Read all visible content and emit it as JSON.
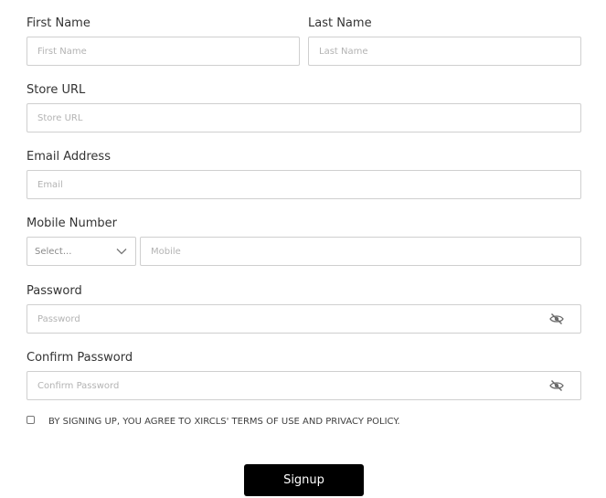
{
  "form": {
    "first_name": {
      "label": "First Name",
      "placeholder": "First Name",
      "value": ""
    },
    "last_name": {
      "label": "Last Name",
      "placeholder": "Last Name",
      "value": ""
    },
    "store_url": {
      "label": "Store URL",
      "placeholder": "Store URL",
      "value": ""
    },
    "email": {
      "label": "Email Address",
      "placeholder": "Email",
      "value": ""
    },
    "mobile": {
      "label": "Mobile Number",
      "country_code_selected": "Select...",
      "placeholder": "Mobile",
      "value": ""
    },
    "password": {
      "label": "Password",
      "placeholder": "Password",
      "value": "",
      "toggle_icon": "eye-slash-icon"
    },
    "confirm_password": {
      "label": "Confirm Password",
      "placeholder": "Confirm Password",
      "value": "",
      "toggle_icon": "eye-slash-icon"
    },
    "terms": {
      "checked": false,
      "text": "BY SIGNING UP, YOU AGREE TO XIRCLS' TERMS OF USE AND PRIVACY POLICY."
    },
    "submit_label": "Signup"
  },
  "colors": {
    "button_background": "#000000",
    "button_text": "#ffffff",
    "field_border": "#cfcfcf",
    "placeholder": "#b3b3b3"
  }
}
